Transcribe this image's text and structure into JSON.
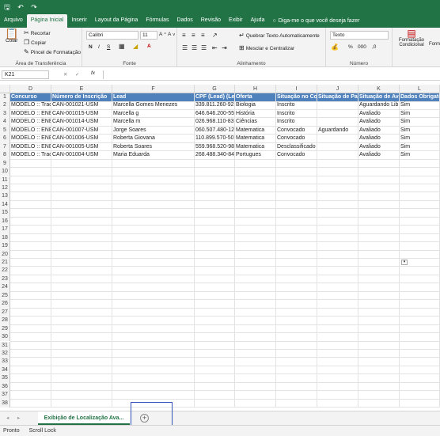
{
  "qat": {
    "autosave_icon": "save-icon",
    "undo_icon": "undo-icon",
    "redo_icon": "redo-icon"
  },
  "tabs": [
    "Arquivo",
    "Página Inicial",
    "Inserir",
    "Layout da Página",
    "Fórmulas",
    "Dados",
    "Revisão",
    "Exibir",
    "Ajuda"
  ],
  "tell_me": "Diga-me o que você deseja fazer",
  "ribbon": {
    "clipboard": {
      "paste": "Colar",
      "cut": "Recortar",
      "copy": "Copiar",
      "format_painter": "Pincel de Formatação",
      "label": "Área de Transferência"
    },
    "font": {
      "name": "Calibri",
      "size": "11",
      "bold": "N",
      "italic": "I",
      "underline": "S",
      "label": "Fonte"
    },
    "alignment": {
      "wrap": "Quebrar Texto Automaticamente",
      "merge": "Mesclar e Centralizar",
      "label": "Alinhamento"
    },
    "number": {
      "format": "Texto",
      "label": "Número"
    },
    "styles": {
      "conditional": "Formatação Condicional",
      "format_as": "Form"
    }
  },
  "formula_bar": {
    "name_box": "K21",
    "fx": "fx",
    "value": ""
  },
  "columns": [
    "D",
    "E",
    "F",
    "G",
    "H",
    "I",
    "J",
    "K",
    "L"
  ],
  "header_row": [
    "Concurso",
    "Número de Inscrição",
    "Lead",
    "CPF (Lead) (Lea",
    "Oferta",
    "Situação no Cor",
    "Situação de Pag",
    "Situação de Ava",
    "Dados Obrigató"
  ],
  "rows": [
    [
      "MODELO :: Trad",
      "CAN-001021-USM",
      "Marcella Gomes Menezes",
      "339.811.260-92",
      "Biologia",
      "Inscrito",
      "",
      "Aguardando Lib",
      "Sim"
    ],
    [
      "MODELO :: ENEI",
      "CAN-001015-USM",
      "Marcella g",
      "646.646.200-55",
      "História",
      "Inscrito",
      "",
      "Avaliado",
      "Sim"
    ],
    [
      "MODELO :: ENEI",
      "CAN-001014-USM",
      "Marcella m",
      "026.968.110-83",
      "Ciências",
      "Inscrito",
      "",
      "Avaliado",
      "Sim"
    ],
    [
      "MODELO :: ENEI",
      "CAN-001007-USM",
      "Jorge Soares",
      "060.507.480-12",
      "Matematica",
      "Convocado",
      "Aguardando",
      "Avaliado",
      "Sim"
    ],
    [
      "MODELO :: ENEI",
      "CAN-001006-USM",
      "Roberta Giovana",
      "110.899.570-50",
      "Matematica",
      "Convocado",
      "",
      "Avaliado",
      "Sim"
    ],
    [
      "MODELO :: ENEI",
      "CAN-001005-USM",
      "Roberta Soares",
      "559.968.520-98",
      "Matematica",
      "Desclassificado",
      "",
      "Avaliado",
      "Sim"
    ],
    [
      "MODELO :: Trad",
      "CAN-001004-USM",
      "Maria Eduarda",
      "268.488.340-84",
      "Portugues",
      "Convocado",
      "",
      "Avaliado",
      "Sim"
    ]
  ],
  "row_numbers": [
    "1",
    "2",
    "3",
    "4",
    "5",
    "6",
    "7",
    "8",
    "9",
    "10",
    "11",
    "12",
    "13",
    "14",
    "15",
    "16",
    "17",
    "18",
    "19",
    "20",
    "21",
    "22",
    "23",
    "24",
    "25",
    "26",
    "27",
    "28",
    "29",
    "30",
    "31",
    "32",
    "33",
    "34",
    "35",
    "36",
    "37",
    "38"
  ],
  "sheet_tab": "Exibição de Localização Ava...",
  "status": {
    "ready": "Pronto",
    "scroll_lock": "Scroll Lock"
  },
  "colors": {
    "accent": "#217346",
    "header_fill": "#4f81bd"
  }
}
